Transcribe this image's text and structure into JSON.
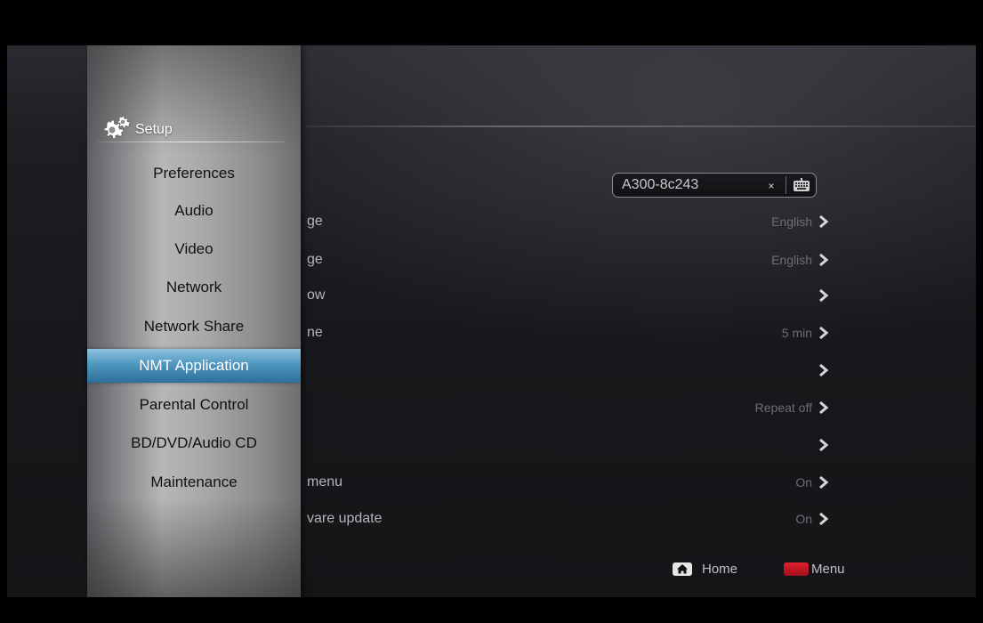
{
  "sidebar": {
    "title": "Setup",
    "icon": "gears-icon",
    "items": [
      {
        "label": "Preferences",
        "selected": false
      },
      {
        "label": "Audio",
        "selected": false
      },
      {
        "label": "Video",
        "selected": false
      },
      {
        "label": "Network",
        "selected": false
      },
      {
        "label": "Network Share",
        "selected": false
      },
      {
        "label": "NMT Application",
        "selected": true
      },
      {
        "label": "Parental Control",
        "selected": false
      },
      {
        "label": "BD/DVD/Audio CD",
        "selected": false
      },
      {
        "label": "Maintenance",
        "selected": false
      }
    ]
  },
  "device_name": {
    "value": "A300-8c243",
    "clear_glyph": "×"
  },
  "settings": [
    {
      "label": "ge",
      "value": "English"
    },
    {
      "label": "ge",
      "value": "English"
    },
    {
      "label": "ow",
      "value": ""
    },
    {
      "label": "ne",
      "value": "5 min"
    },
    {
      "label": "",
      "value": ""
    },
    {
      "label": "",
      "value": "Repeat off"
    },
    {
      "label": "",
      "value": ""
    },
    {
      "label": "menu",
      "value": "On"
    },
    {
      "label": "vare update",
      "value": "On"
    }
  ],
  "legend": {
    "home_label": "Home",
    "menu_label": "Menu"
  },
  "colors": {
    "selection": "#4f97c0",
    "menu_key": "#d0202e"
  }
}
